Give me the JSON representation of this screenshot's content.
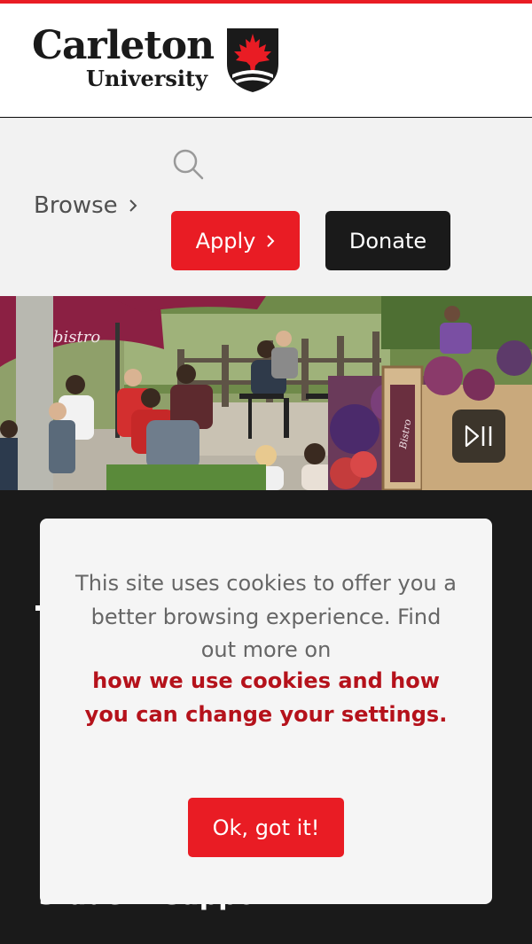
{
  "header": {
    "logo_line1": "Carleton",
    "logo_line2": "University",
    "logo_icon": "maple-leaf-shield-icon"
  },
  "nav": {
    "search_icon": "search-icon",
    "browse_label": "Browse",
    "apply_label": "Apply",
    "donate_label": "Donate"
  },
  "hero": {
    "control_icon": "play-pause-icon",
    "umbrella_text": "bistro",
    "sign_text": "Bistro"
  },
  "background": {
    "partial_text": "student support."
  },
  "cookie_banner": {
    "message": "This site uses cookies to offer you a better browsing experience. Find out more on",
    "link_text": "how we use cookies and how you can change your settings.",
    "ok_label": "Ok, got it!"
  },
  "colors": {
    "brand_red": "#e91c24",
    "link_red": "#b5121b",
    "dark": "#1a1a1a"
  }
}
